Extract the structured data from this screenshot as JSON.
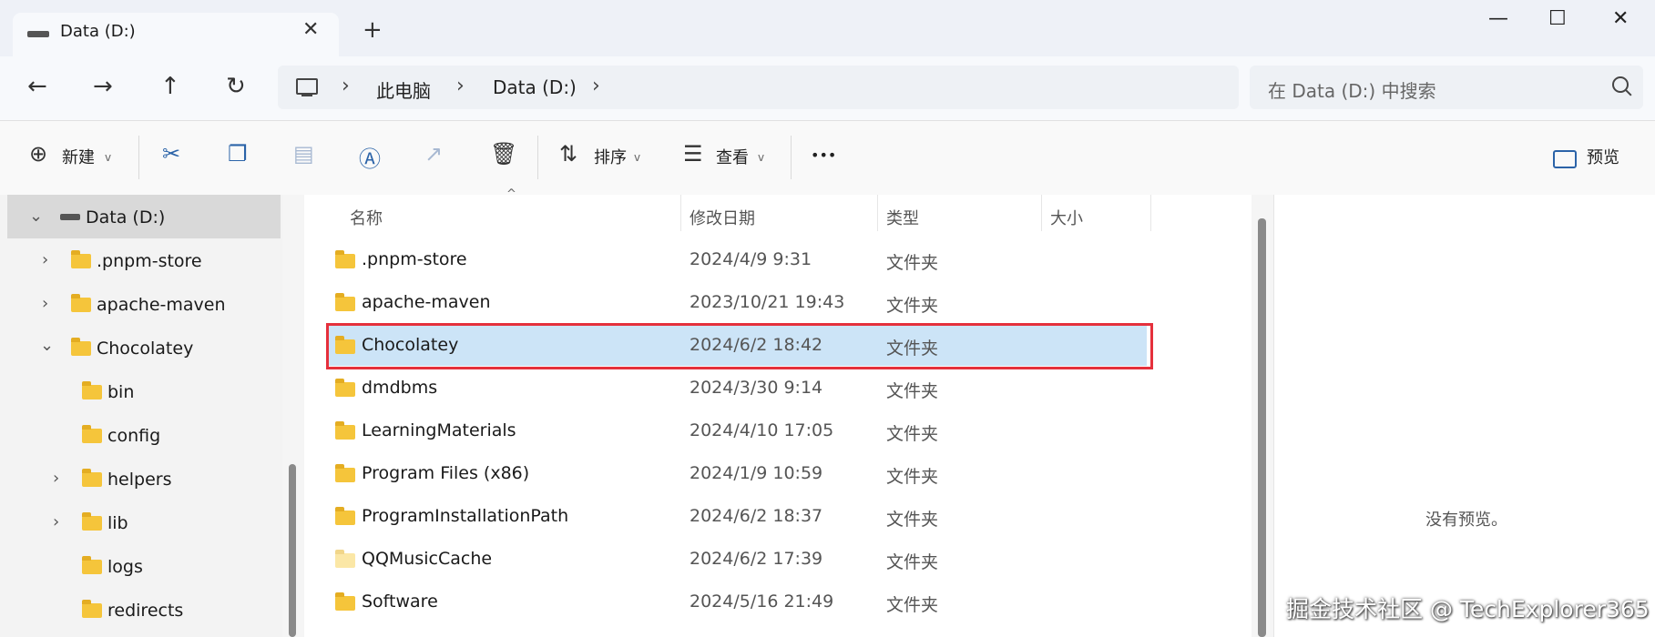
{
  "window": {
    "tab_title": "Data (D:)",
    "tab_close": "✕",
    "new_tab": "+",
    "minimize": "—",
    "maximize": "☐",
    "close": "✕"
  },
  "nav": {
    "back": "←",
    "forward": "→",
    "up": "↑",
    "refresh": "↻"
  },
  "address": {
    "breadcrumb": [
      "此电脑",
      "Data (D:)"
    ],
    "search_placeholder": "在 Data (D:) 中搜索"
  },
  "toolbar": {
    "new_label": "新建",
    "sort_label": "排序",
    "view_label": "查看",
    "more_label": "•••",
    "preview_label": "预览"
  },
  "sidebar": {
    "drive_label": "Data (D:)",
    "items": [
      {
        "label": ".pnpm-store",
        "expanded": false
      },
      {
        "label": "apache-maven",
        "expanded": false
      },
      {
        "label": "Chocolatey",
        "expanded": true
      },
      {
        "label": "bin",
        "expanded": null
      },
      {
        "label": "config",
        "expanded": null
      },
      {
        "label": "helpers",
        "expanded": false
      },
      {
        "label": "lib",
        "expanded": false
      },
      {
        "label": "logs",
        "expanded": null
      },
      {
        "label": "redirects",
        "expanded": null
      }
    ]
  },
  "file_list": {
    "columns": [
      "名称",
      "修改日期",
      "类型",
      "大小"
    ],
    "sort_indicator": "^",
    "selected_row": 2,
    "rows": [
      {
        "name": ".pnpm-store",
        "date": "2024/4/9 9:31",
        "type": "文件夹",
        "size": ""
      },
      {
        "name": "apache-maven",
        "date": "2023/10/21 19:43",
        "type": "文件夹",
        "size": ""
      },
      {
        "name": "Chocolatey",
        "date": "2024/6/2 18:42",
        "type": "文件夹",
        "size": ""
      },
      {
        "name": "dmdbms",
        "date": "2024/3/30 9:14",
        "type": "文件夹",
        "size": ""
      },
      {
        "name": "LearningMaterials",
        "date": "2024/4/10 17:05",
        "type": "文件夹",
        "size": ""
      },
      {
        "name": "Program Files (x86)",
        "date": "2024/1/9 10:59",
        "type": "文件夹",
        "size": ""
      },
      {
        "name": "ProgramInstallationPath",
        "date": "2024/6/2 18:37",
        "type": "文件夹",
        "size": ""
      },
      {
        "name": "QQMusicCache",
        "date": "2024/6/2 17:39",
        "type": "文件夹",
        "size": ""
      },
      {
        "name": "Software",
        "date": "2024/5/16 21:49",
        "type": "文件夹",
        "size": ""
      }
    ]
  },
  "preview_pane": {
    "empty_text": "没有预览。"
  },
  "watermark": "掘金技术社区 @ TechExplorer365",
  "colors": {
    "selection": "#cce4f7",
    "highlight_border": "#e5303c",
    "folder": "#f5c53b",
    "accent_icon": "#2b63a8"
  }
}
